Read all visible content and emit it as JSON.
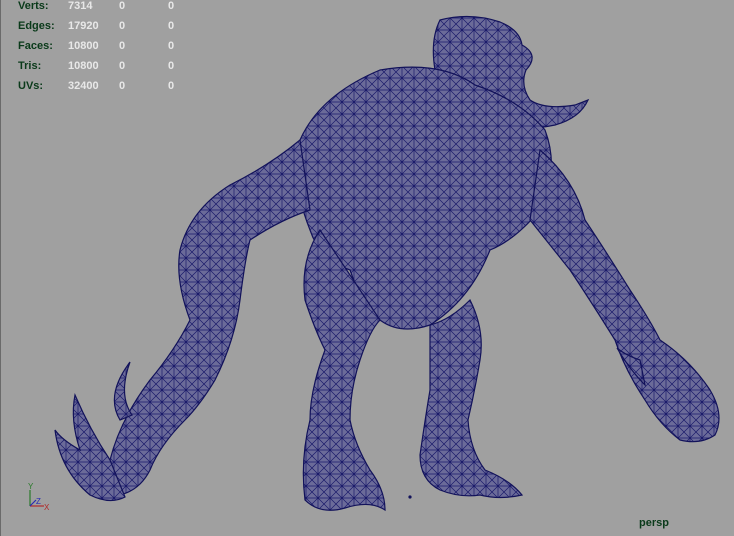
{
  "hud": {
    "rows": [
      {
        "label": "Verts:",
        "v1": "7314",
        "v2": "0",
        "v3": "0"
      },
      {
        "label": "Edges:",
        "v1": "17920",
        "v2": "0",
        "v3": "0"
      },
      {
        "label": "Faces:",
        "v1": "10800",
        "v2": "0",
        "v3": "0"
      },
      {
        "label": "Tris:",
        "v1": "10800",
        "v2": "0",
        "v3": "0"
      },
      {
        "label": "UVs:",
        "v1": "32400",
        "v2": "0",
        "v3": "0"
      }
    ]
  },
  "camera": {
    "name": "persp"
  },
  "axis": {
    "y": "Y",
    "x": "X",
    "z": "Z"
  },
  "colors": {
    "background": "#a0a0a0",
    "wire": "#1a1a6a",
    "fill": "#6a6a98",
    "hud_text": "#e8e8e8",
    "hud_label": "#0a3a1a"
  },
  "icons": {
    "axis_gizmo": "axis-gizmo-icon"
  }
}
